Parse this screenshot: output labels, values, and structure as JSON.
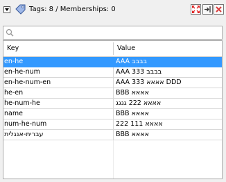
{
  "header": {
    "title": "Tags: 8 / Memberships: 0"
  },
  "search": {
    "value": "",
    "placeholder": ""
  },
  "table": {
    "columns": [
      "Key",
      "Value"
    ],
    "rows": [
      {
        "key": "en-he",
        "value": "AAA בבבב",
        "selected": true
      },
      {
        "key": "en-he-num",
        "value": "AAA 333 בבבב",
        "selected": false
      },
      {
        "key": "en-he-num-en",
        "value": "AAA 333 אאאא DDD",
        "selected": false
      },
      {
        "key": "he-en",
        "value": "BBB אאאא",
        "selected": false
      },
      {
        "key": "he-num-he",
        "value": "אאאא 222 גגגג",
        "selected": false
      },
      {
        "key": "name",
        "value": "BBB אאאא",
        "selected": false
      },
      {
        "key": "num-he-num",
        "value": "222 אאאא 111",
        "selected": false
      },
      {
        "key": "עברית-אנגלית",
        "value": "BBB אאאא",
        "selected": false
      }
    ]
  },
  "icons": {
    "collapse": "chevron-down-icon",
    "tag": "tag-icon",
    "expand": "expand-arrows-icon",
    "dock": "dock-icon",
    "close": "close-icon",
    "search": "search-icon"
  },
  "colors": {
    "selection": "#3399ff",
    "close_red": "#d83c3c",
    "expand_red": "#e02020"
  }
}
